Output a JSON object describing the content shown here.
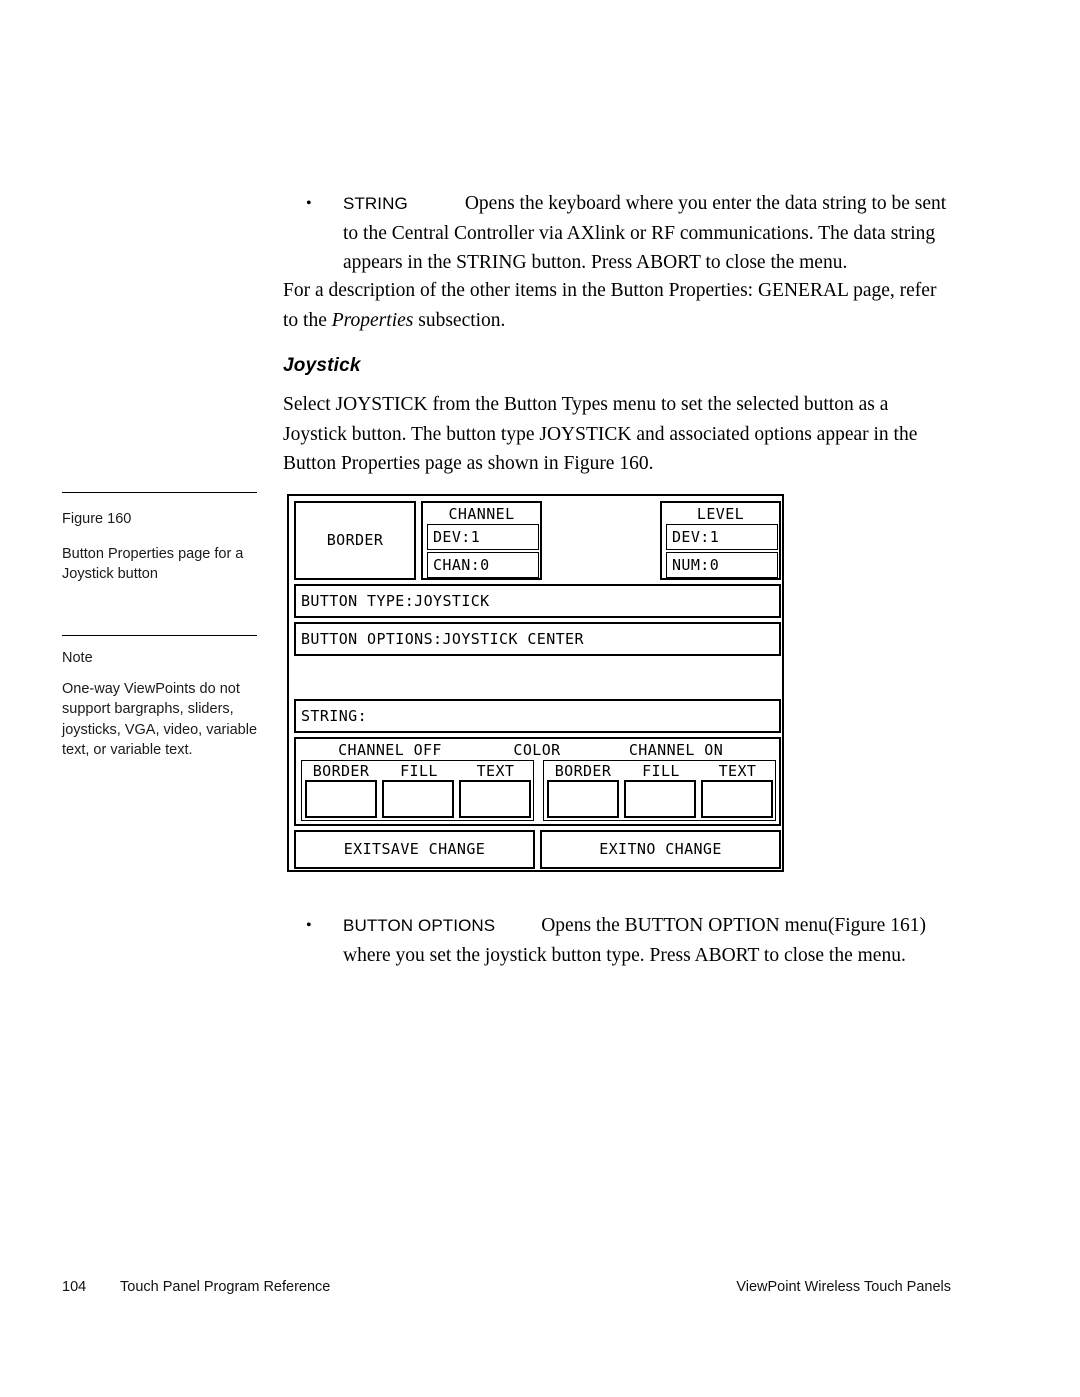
{
  "body": {
    "bullet_string": {
      "term": "STRING",
      "text": "Opens the keyboard where you enter the data string to be sent to the Central Controller via AXlink or RF communications. The data string appears in the STRING button. Press ABORT to close the menu."
    },
    "paragraph_general": {
      "before": "For a description of the other items in the Button Properties: GENERAL page, refer to the ",
      "italic": "Properties",
      "after": " subsection."
    },
    "heading": "Joystick",
    "paragraph_joystick": "Select JOYSTICK from the Button Types menu to set the selected button as a Joystick button. The button type JOYSTICK and associated options appear in the Button Properties page as shown in Figure 160.",
    "bullet_button_options": {
      "term": "BUTTON OPTIONS",
      "text": "Opens the BUTTON OPTION menu(Figure 161) where you set the joystick button type. Press ABORT to close the menu."
    }
  },
  "margin": {
    "figure_label": "Figure 160",
    "figure_caption": "Button Properties page for a Joystick button",
    "note_label": "Note",
    "note_text": "One-way ViewPoints do not support bargraphs, sliders, joysticks, VGA, video, variable text, or variable text."
  },
  "figure": {
    "border_button": "BORDER",
    "channel_group": {
      "title": "CHANNEL",
      "dev": "DEV:1",
      "chan": "CHAN:0"
    },
    "level_group": {
      "title": "LEVEL",
      "dev": "DEV:1",
      "num": "NUM:0"
    },
    "button_type": "BUTTON TYPE:JOYSTICK",
    "button_options": "BUTTON OPTIONS:JOYSTICK CENTER",
    "string_field": "STRING:",
    "color_section": {
      "channel_off_title": "CHANNEL OFF",
      "color_title": "COLOR",
      "channel_on_title": "CHANNEL ON",
      "off_labels": [
        "BORDER",
        "FILL",
        "TEXT"
      ],
      "on_labels": [
        "BORDER",
        "FILL",
        "TEXT"
      ],
      "swatch_color": "#ffffff"
    },
    "exit_save": {
      "line1": "EXIT",
      "line2": "SAVE CHANGE"
    },
    "exit_nosave": {
      "line1": "EXIT",
      "line2": "NO CHANGE"
    }
  },
  "footer": {
    "page_number": "104",
    "left_title": "Touch Panel Program Reference",
    "right_title": "ViewPoint Wireless Touch Panels"
  }
}
